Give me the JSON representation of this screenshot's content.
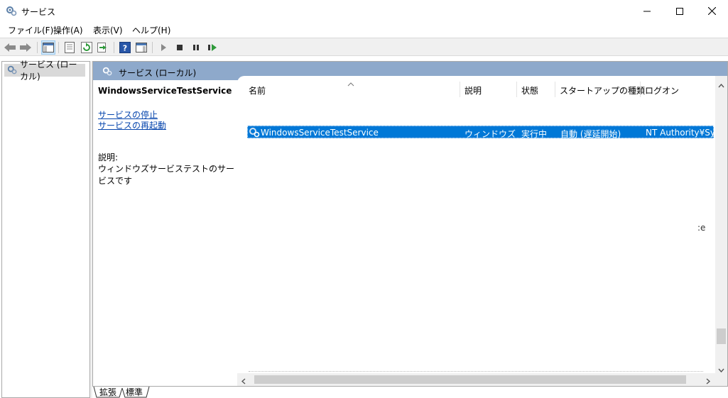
{
  "window": {
    "title": "サービス",
    "minimize_icon": "minimize-icon",
    "maximize_icon": "maximize-icon",
    "close_icon": "close-icon"
  },
  "menu": [
    "ファイル(F)",
    "操作(A)",
    "表示(V)",
    "ヘルプ(H)"
  ],
  "toolbar": {
    "icons": [
      "back-arrow-icon",
      "forward-arrow-icon",
      "console-tree-icon",
      "properties-icon",
      "refresh-icon",
      "export-list-icon",
      "help-icon",
      "action-pane-icon",
      "play-icon",
      "stop-icon",
      "pause-icon",
      "restart-icon"
    ]
  },
  "tree": {
    "item": "サービス (ローカル)"
  },
  "main": {
    "header_title": "サービス (ローカル)",
    "detail": {
      "service_name": "WindowsServiceTestService",
      "stop_link": "サービスの停止",
      "restart_link": "サービスの再起動",
      "desc_label": "説明:",
      "desc_text": "ウィンドウズサービステストのサービスです"
    },
    "columns": [
      "名前",
      "説明",
      "状態",
      "スタートアップの種類",
      "ログオン"
    ],
    "rows": [
      {
        "name": "WindowsServiceTestService",
        "description": "ウィンドウズ...",
        "status": "実行中",
        "startup": "自動 (遅延開始)",
        "logon": "NT Authority¥Syst"
      }
    ],
    "edge_text": ":e"
  },
  "tabs": [
    "拡張",
    "標準"
  ],
  "colors": {
    "header": "#8ea9cb",
    "selection": "#0078d7",
    "link": "#0645ad"
  }
}
